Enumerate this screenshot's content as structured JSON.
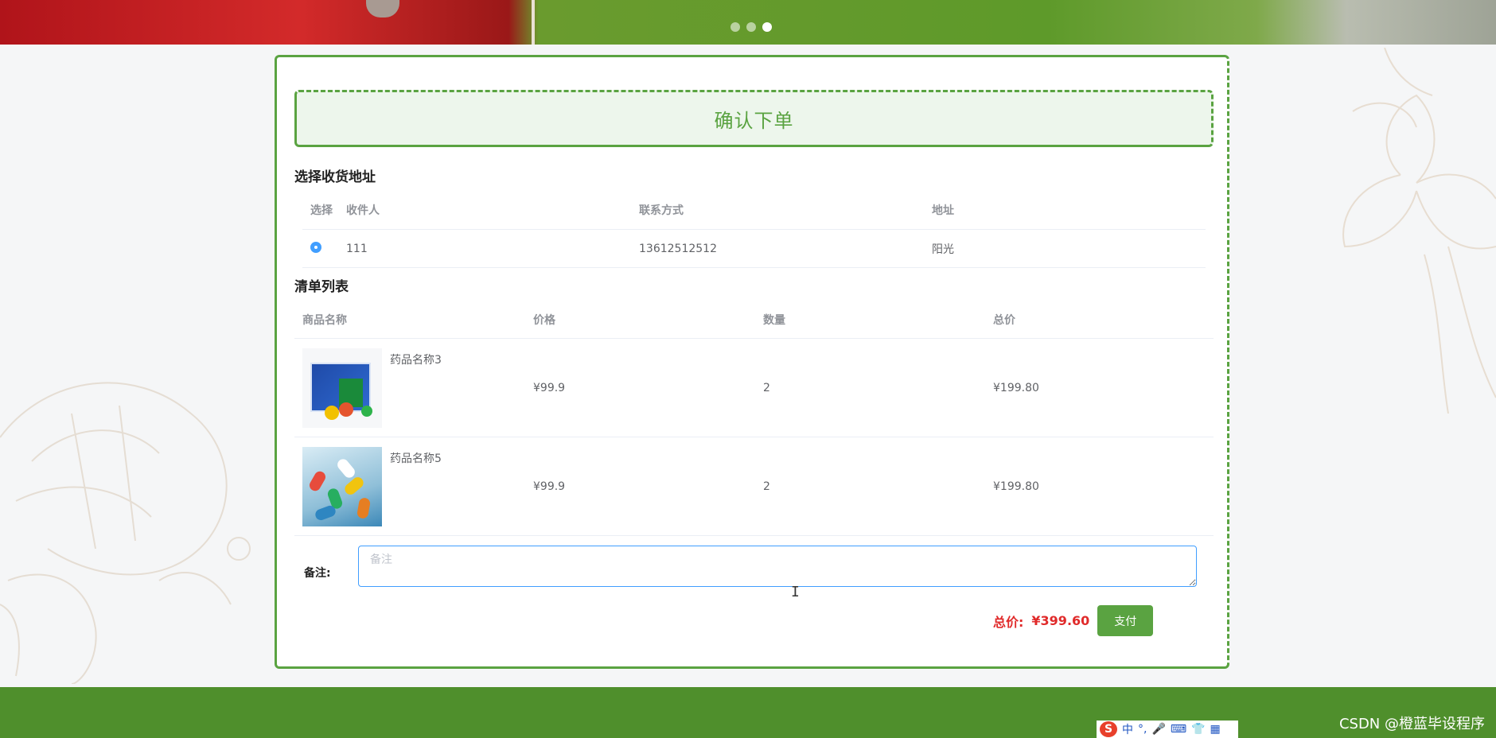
{
  "banner": {
    "slide_count": 3,
    "active_slide": 3
  },
  "order": {
    "title": "确认下单",
    "address_section_title": "选择收货地址",
    "address_columns": [
      "选择",
      "收件人",
      "联系方式",
      "地址"
    ],
    "addresses": [
      {
        "selected": true,
        "name": "111",
        "phone": "13612512512",
        "address": "阳光"
      }
    ],
    "list_section_title": "清单列表",
    "list_columns": [
      "商品名称",
      "价格",
      "数量",
      "总价"
    ],
    "items": [
      {
        "name": "药品名称3",
        "price": "¥99.9",
        "qty": "2",
        "total": "¥199.80",
        "image_icon": "medicine-box-image"
      },
      {
        "name": "药品名称5",
        "price": "¥99.9",
        "qty": "2",
        "total": "¥199.80",
        "image_icon": "capsules-image"
      }
    ],
    "remark_label": "备注:",
    "remark_placeholder": "备注",
    "remark_value": "",
    "total_label": "总价:",
    "total_value": "¥399.60",
    "pay_label": "支付"
  },
  "footer": {
    "credit": "CSDN @橙蓝毕设程序"
  },
  "ime": {
    "label": "中",
    "logo": "S"
  },
  "colors": {
    "accent_green": "#5aa341",
    "price_red": "#e02a2a",
    "radio_blue": "#409eff",
    "footer_green": "#4f8f2c"
  }
}
